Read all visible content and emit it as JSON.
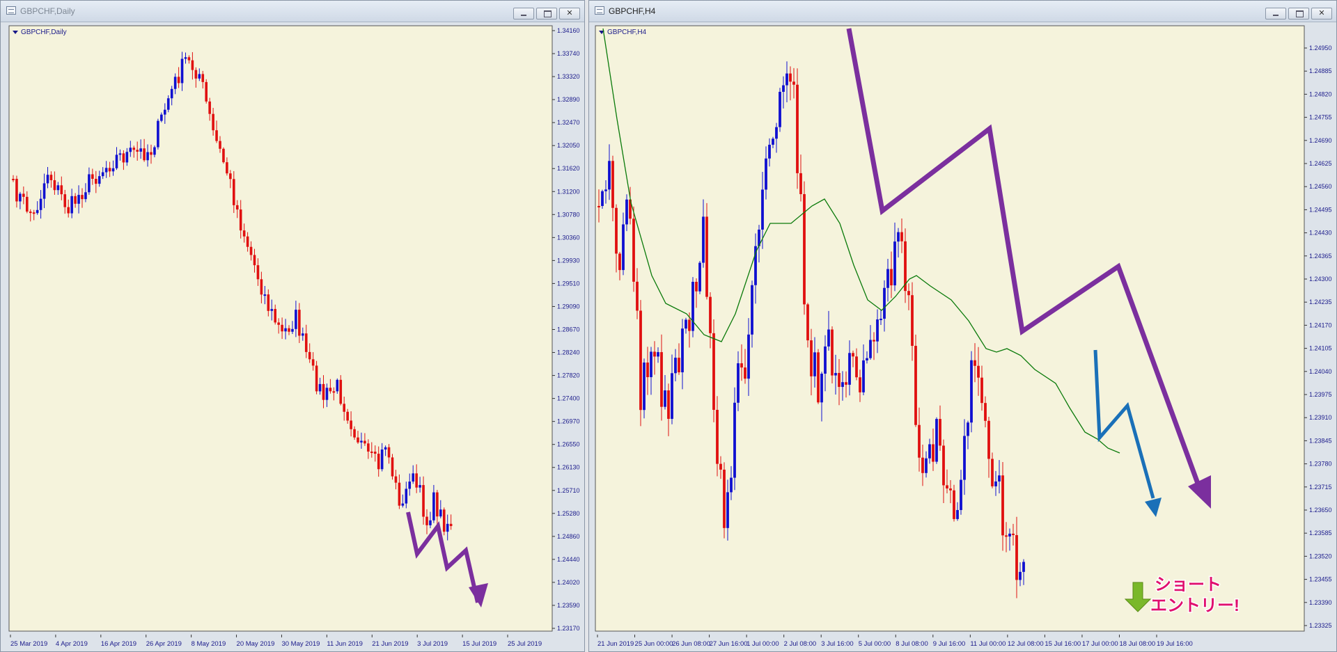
{
  "windows": [
    {
      "title": "GBPCHF,Daily",
      "symbol_label": "GBPCHF,Daily",
      "price_labels": [
        "1.34160",
        "1.33740",
        "1.33320",
        "1.32890",
        "1.32470",
        "1.32050",
        "1.31620",
        "1.31200",
        "1.30780",
        "1.30360",
        "1.29930",
        "1.29510",
        "1.29090",
        "1.28670",
        "1.28240",
        "1.27820",
        "1.27400",
        "1.26970",
        "1.26550",
        "1.26130",
        "1.25710",
        "1.25280",
        "1.24860",
        "1.24440",
        "1.24020",
        "1.23590",
        "1.23170"
      ],
      "time_labels": [
        "25 Mar 2019",
        "4 Apr 2019",
        "16 Apr 2019",
        "26 Apr 2019",
        "8 May 2019",
        "20 May 2019",
        "30 May 2019",
        "11 Jun 2019",
        "21 Jun 2019",
        "3 Jul 2019",
        "15 Jul 2019",
        "25 Jul 2019"
      ]
    },
    {
      "title": "GBPCHF,H4",
      "symbol_label": "GBPCHF,H4",
      "price_labels": [
        "1.24950",
        "1.24885",
        "1.24820",
        "1.24755",
        "1.24690",
        "1.24625",
        "1.24560",
        "1.24495",
        "1.24430",
        "1.24365",
        "1.24300",
        "1.24235",
        "1.24170",
        "1.24105",
        "1.24040",
        "1.23975",
        "1.23910",
        "1.23845",
        "1.23780",
        "1.23715",
        "1.23650",
        "1.23585",
        "1.23520",
        "1.23455",
        "1.23390",
        "1.23325"
      ],
      "time_labels": [
        "21 Jun 2019",
        "25 Jun 00:00",
        "26 Jun 08:00",
        "27 Jun 16:00",
        "1 Jul 00:00",
        "2 Jul 08:00",
        "3 Jul 16:00",
        "5 Jul 00:00",
        "8 Jul 08:00",
        "9 Jul 16:00",
        "11 Jul 00:00",
        "12 Jul 08:00",
        "15 Jul 16:00",
        "17 Jul 00:00",
        "18 Jul 08:00",
        "19 Jul 16:00"
      ],
      "annotation": {
        "line1": "ショート",
        "line2": "エントリー!"
      }
    }
  ],
  "colors": {
    "chart_bg": "#f5f3dc",
    "bull": "#1010d0",
    "bear": "#e01010",
    "axis_text": "#1a1a8a",
    "ma_line": "#0a7a0a",
    "arrow_purple": "#7b2f9e",
    "arrow_blue": "#1a70b8",
    "annotation_text": "#e0106e",
    "down_arrow_green": "#7ab82a"
  },
  "icons": [
    "window-app-icon",
    "minimize-icon",
    "maximize-icon",
    "close-icon",
    "symbol-dropdown-icon",
    "down-arrow-icon"
  ]
}
